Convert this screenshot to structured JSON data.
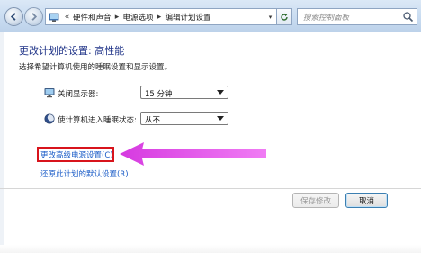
{
  "breadcrumb": {
    "overflow": "«",
    "items": [
      "硬件和声音",
      "电源选项",
      "编辑计划设置"
    ],
    "separator": "▸",
    "dropdown": "▾"
  },
  "search": {
    "placeholder": "搜索控制面板"
  },
  "page": {
    "title": "更改计划的设置: 高性能",
    "subtitle": "选择希望计算机使用的睡眠设置和显示设置。"
  },
  "settings": {
    "display_off": {
      "label": "关闭显示器:",
      "value": "15 分钟"
    },
    "sleep": {
      "label": "使计算机进入睡眠状态:",
      "value": "从不"
    }
  },
  "links": {
    "advanced": "更改高级电源设置(C)",
    "restore": "还原此计划的默认设置(R)"
  },
  "buttons": {
    "save": "保存修改",
    "cancel": "取消"
  },
  "colors": {
    "link": "#1d5ec8",
    "title": "#1e3287",
    "annotation_box": "#d8141c",
    "annotation_arrow": "#e040e8"
  },
  "icons": [
    "back-arrow-icon",
    "forward-arrow-icon",
    "control-panel-icon",
    "refresh-icon",
    "search-icon",
    "monitor-icon",
    "moon-icon"
  ]
}
